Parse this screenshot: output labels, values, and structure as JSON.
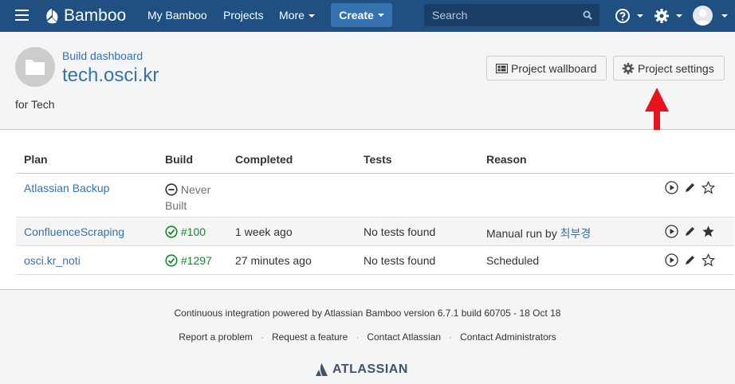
{
  "nav": {
    "app_name": "Bamboo",
    "links": [
      "My Bamboo",
      "Projects"
    ],
    "more_label": "More",
    "create_label": "Create",
    "search_placeholder": "Search",
    "brand_color": "#205081"
  },
  "header": {
    "breadcrumb": "Build dashboard",
    "title": "tech.osci.kr",
    "description": "for Tech",
    "wallboard_label": "Project wallboard",
    "settings_label": "Project settings"
  },
  "table": {
    "columns": [
      "Plan",
      "Build",
      "Completed",
      "Tests",
      "Reason"
    ],
    "rows": [
      {
        "plan": "Atlassian Backup",
        "build_status": "never",
        "build": "Never Built",
        "completed": "",
        "tests": "",
        "reason": "",
        "reason_user": "",
        "favourite": false
      },
      {
        "plan": "ConfluenceScraping",
        "build_status": "success",
        "build": "#100",
        "completed": "1 week ago",
        "tests": "No tests found",
        "reason": "Manual run by",
        "reason_user": "최부경",
        "favourite": true
      },
      {
        "plan": "osci.kr_noti",
        "build_status": "success",
        "build": "#1297",
        "completed": "27 minutes ago",
        "tests": "No tests found",
        "reason": "Scheduled",
        "reason_user": "",
        "favourite": false
      }
    ]
  },
  "footer": {
    "powered": "Continuous integration powered by Atlassian Bamboo version 6.7.1 build 60705 - 18 Oct 18",
    "links": [
      "Report a problem",
      "Request a feature",
      "Contact Atlassian",
      "Contact Administrators"
    ],
    "atlassian_label": "ATLASSIAN"
  }
}
